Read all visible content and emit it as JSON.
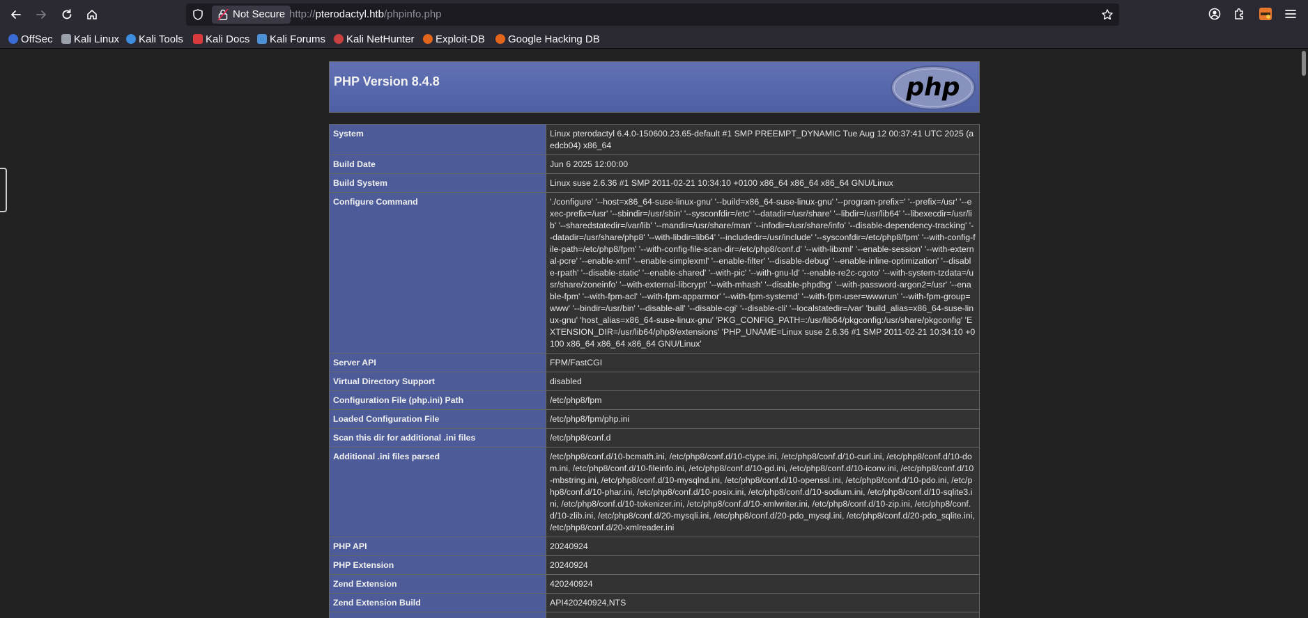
{
  "browser": {
    "security_label": "Not Secure",
    "url_scheme": "http://",
    "url_host": "pterodactyl.htb",
    "url_path": "/phpinfo.php",
    "bookmarks": [
      {
        "label": "OffSec",
        "icon": "offsec-icon"
      },
      {
        "label": "Kali Linux",
        "icon": "kali-dragon-icon"
      },
      {
        "label": "Kali Tools",
        "icon": "kali-tools-icon"
      },
      {
        "label": "Kali Docs",
        "icon": "kali-docs-icon"
      },
      {
        "label": "Kali Forums",
        "icon": "kali-forums-icon"
      },
      {
        "label": "Kali NetHunter",
        "icon": "nethunter-icon"
      },
      {
        "label": "Exploit-DB",
        "icon": "exploit-db-icon"
      },
      {
        "label": "Google Hacking DB",
        "icon": "ghdb-icon"
      }
    ]
  },
  "phpinfo": {
    "title": "PHP Version 8.4.8",
    "logo_text": "php",
    "rows": [
      {
        "key": "System",
        "value": "Linux pterodactyl 6.4.0-150600.23.65-default #1 SMP PREEMPT_DYNAMIC Tue Aug 12 00:37:41 UTC 2025 (aedcb04) x86_64"
      },
      {
        "key": "Build Date",
        "value": "Jun 6 2025 12:00:00"
      },
      {
        "key": "Build System",
        "value": "Linux suse 2.6.36 #1 SMP 2011-02-21 10:34:10 +0100 x86_64 x86_64 x86_64 GNU/Linux"
      },
      {
        "key": "Configure Command",
        "value": "'./configure' '--host=x86_64-suse-linux-gnu' '--build=x86_64-suse-linux-gnu' '--program-prefix=' '--prefix=/usr' '--exec-prefix=/usr' '--sbindir=/usr/sbin' '--sysconfdir=/etc' '--datadir=/usr/share' '--libdir=/usr/lib64' '--libexecdir=/usr/lib' '--sharedstatedir=/var/lib' '--mandir=/usr/share/man' '--infodir=/usr/share/info' '--disable-dependency-tracking' '--datadir=/usr/share/php8' '--with-libdir=lib64' '--includedir=/usr/include' '--sysconfdir=/etc/php8/fpm' '--with-config-file-path=/etc/php8/fpm' '--with-config-file-scan-dir=/etc/php8/conf.d' '--with-libxml' '--enable-session' '--with-external-pcre' '--enable-xml' '--enable-simplexml' '--enable-filter' '--disable-debug' '--enable-inline-optimization' '--disable-rpath' '--disable-static' '--enable-shared' '--with-pic' '--with-gnu-ld' '--enable-re2c-cgoto' '--with-system-tzdata=/usr/share/zoneinfo' '--with-external-libcrypt' '--with-mhash' '--disable-phpdbg' '--with-password-argon2=/usr' '--enable-fpm' '--with-fpm-acl' '--with-fpm-apparmor' '--with-fpm-systemd' '--with-fpm-user=wwwrun' '--with-fpm-group=www' '--bindir=/usr/bin' '--disable-all' '--disable-cgi' '--disable-cli' '--localstatedir=/var' 'build_alias=x86_64-suse-linux-gnu' 'host_alias=x86_64-suse-linux-gnu' 'PKG_CONFIG_PATH=:/usr/lib64/pkgconfig:/usr/share/pkgconfig' 'EXTENSION_DIR=/usr/lib64/php8/extensions' 'PHP_UNAME=Linux suse 2.6.36 #1 SMP 2011-02-21 10:34:10 +0100 x86_64 x86_64 x86_64 GNU/Linux'"
      },
      {
        "key": "Server API",
        "value": "FPM/FastCGI"
      },
      {
        "key": "Virtual Directory Support",
        "value": "disabled"
      },
      {
        "key": "Configuration File (php.ini) Path",
        "value": "/etc/php8/fpm"
      },
      {
        "key": "Loaded Configuration File",
        "value": "/etc/php8/fpm/php.ini"
      },
      {
        "key": "Scan this dir for additional .ini files",
        "value": "/etc/php8/conf.d"
      },
      {
        "key": "Additional .ini files parsed",
        "value": "/etc/php8/conf.d/10-bcmath.ini, /etc/php8/conf.d/10-ctype.ini, /etc/php8/conf.d/10-curl.ini, /etc/php8/conf.d/10-dom.ini, /etc/php8/conf.d/10-fileinfo.ini, /etc/php8/conf.d/10-gd.ini, /etc/php8/conf.d/10-iconv.ini, /etc/php8/conf.d/10-mbstring.ini, /etc/php8/conf.d/10-mysqlnd.ini, /etc/php8/conf.d/10-openssl.ini, /etc/php8/conf.d/10-pdo.ini, /etc/php8/conf.d/10-phar.ini, /etc/php8/conf.d/10-posix.ini, /etc/php8/conf.d/10-sodium.ini, /etc/php8/conf.d/10-sqlite3.ini, /etc/php8/conf.d/10-tokenizer.ini, /etc/php8/conf.d/10-xmlwriter.ini, /etc/php8/conf.d/10-zip.ini, /etc/php8/conf.d/10-zlib.ini, /etc/php8/conf.d/20-mysqli.ini, /etc/php8/conf.d/20-pdo_mysql.ini, /etc/php8/conf.d/20-pdo_sqlite.ini, /etc/php8/conf.d/20-xmlreader.ini"
      },
      {
        "key": "PHP API",
        "value": "20240924"
      },
      {
        "key": "PHP Extension",
        "value": "20240924"
      },
      {
        "key": "Zend Extension",
        "value": "420240924"
      },
      {
        "key": "Zend Extension Build",
        "value": "API420240924,NTS"
      },
      {
        "key": "",
        "value": ""
      }
    ]
  }
}
